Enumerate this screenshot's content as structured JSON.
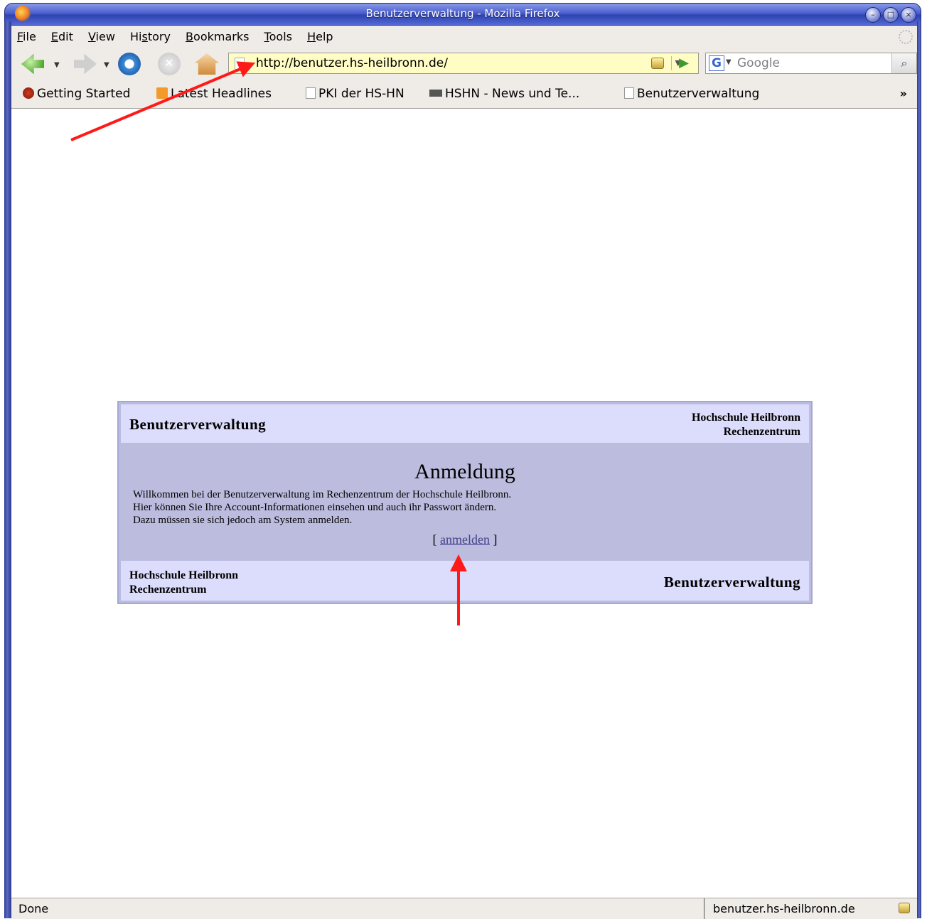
{
  "window": {
    "title": "Benutzerverwaltung - Mozilla Firefox"
  },
  "menubar": {
    "items": [
      {
        "label": "File",
        "accel": "F",
        "rest": "ile"
      },
      {
        "label": "Edit",
        "accel": "E",
        "rest": "dit"
      },
      {
        "label": "View",
        "accel": "V",
        "rest": "iew"
      },
      {
        "label": "History",
        "pre": "Hi",
        "accel": "s",
        "rest": "tory"
      },
      {
        "label": "Bookmarks",
        "accel": "B",
        "rest": "ookmarks"
      },
      {
        "label": "Tools",
        "accel": "T",
        "rest": "ools"
      },
      {
        "label": "Help",
        "accel": "H",
        "rest": "elp"
      }
    ]
  },
  "navbar": {
    "url": "http://benutzer.hs-heilbronn.de/",
    "search_placeholder": "Google"
  },
  "bookmarks": {
    "items": [
      "Getting Started",
      "Latest Headlines",
      "PKI der HS-HN",
      "HSHN - News und Te...",
      "Benutzerverwaltung"
    ],
    "more": "»"
  },
  "panel": {
    "header_title": "Benutzerverwaltung",
    "institution_line1": "Hochschule Heilbronn",
    "institution_line2": "Rechenzentrum",
    "heading": "Anmeldung",
    "message_line1": "Willkommen bei der Benutzerverwaltung im Rechenzentrum der Hochschule Heilbronn.",
    "message_line2": "Hier können Sie Ihre Account-Informationen einsehen und auch ihr Passwort ändern.",
    "message_line3": "Dazu müssen sie sich jedoch am System anmelden.",
    "login_open": "[ ",
    "login_link": "anmelden",
    "login_close": " ]",
    "footer_title": "Benutzerverwaltung"
  },
  "statusbar": {
    "status": "Done",
    "host": "benutzer.hs-heilbronn.de"
  },
  "annotations": {
    "arrow_color": "#ff1a1a"
  }
}
